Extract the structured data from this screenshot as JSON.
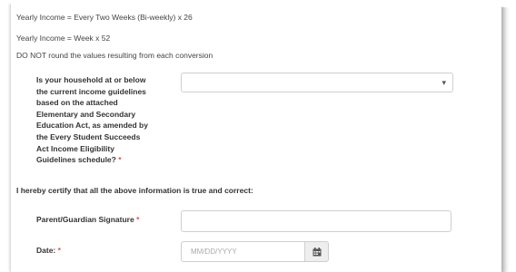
{
  "conversions": {
    "biweekly": "Yearly Income = Every Two Weeks (Bi-weekly) x 26",
    "weekly": "Yearly Income = Week x 52",
    "note": "DO NOT round the values resulting from each conversion"
  },
  "question": {
    "lines": [
      "Is your household at or below",
      "the current income guidelines",
      "based on the attached",
      "Elementary and Secondary",
      "Education Act, as amended by",
      "the Every Student Succeeds",
      "Act Income Eligibility",
      "Guidelines schedule?"
    ],
    "required_marker": "*",
    "selected_value": ""
  },
  "certify_text": "I hereby certify that all the above information is true and correct:",
  "signature": {
    "label": "Parent/Guardian Signature",
    "required_marker": "*",
    "value": ""
  },
  "date": {
    "label": "Date:",
    "required_marker": "*",
    "placeholder": "MM/DD/YYYY"
  },
  "icons": {
    "select_caret": "chevron-down-icon",
    "date_picker": "calendar-icon"
  },
  "colors": {
    "required": "#d9534f",
    "border": "#cfcfcf"
  }
}
